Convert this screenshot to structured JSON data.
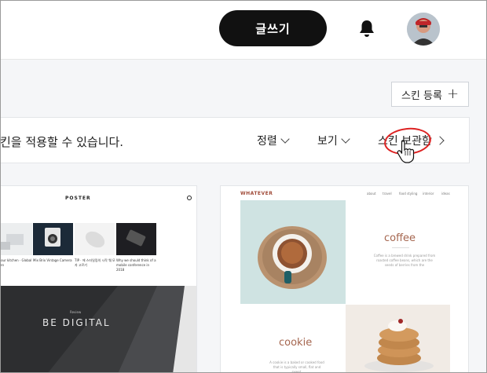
{
  "header": {
    "write_label": "글쓰기",
    "bell_icon": "bell-icon",
    "avatar_icon": "user-avatar"
  },
  "actions": {
    "register_label": "스킨 등록",
    "register_icon": "plus-icon"
  },
  "toolbar": {
    "description": "킨을 적용할 수 있습니다.",
    "sort_label": "정렬",
    "view_label": "보기",
    "storage_label": "스킨 보관함"
  },
  "skins": {
    "poster": {
      "logo": "POSTER",
      "captions": [
        "...y, your kitchen · Global Kitchen",
        "Mix Brix Vintage Camera",
        "TIP · 에 스타일링의 시작 웨 모자 고르기",
        "Why we should think of a mobile conference in 2018"
      ],
      "banner_sub": "Review",
      "banner_title": "BE DIGITAL"
    },
    "whatever": {
      "logo": "WHATEVER",
      "nav": [
        "about",
        "travel",
        "food styling",
        "interior",
        "ideas"
      ],
      "coffee_title": "coffee",
      "coffee_text": "Coffee is a brewed drink prepared from roasted coffee beans, which are the seeds of berries from the",
      "cookie_title": "cookie",
      "cookie_text": "A cookie is a baked or cooked food that is typically small, flat and sweet."
    }
  },
  "colors": {
    "accent_dark": "#111111",
    "highlight_circle": "#dd2222",
    "whatever_brand": "#a04a38"
  }
}
